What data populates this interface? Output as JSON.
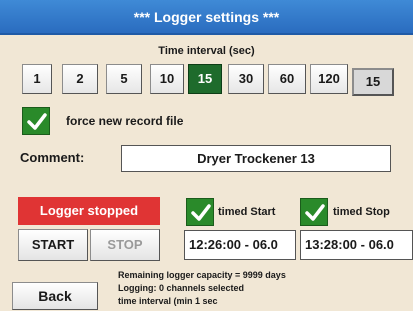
{
  "window": {
    "title": "***  Logger settings  ***"
  },
  "time_interval": {
    "label": "Time interval (sec)",
    "options": [
      "1",
      "2",
      "5",
      "10",
      "15",
      "30",
      "60",
      "120"
    ],
    "selected": "15",
    "current_value": "15"
  },
  "force_new_record": {
    "label": "force new record file",
    "checked": true
  },
  "comment": {
    "label": "Comment:",
    "value": "Dryer Trockener 13"
  },
  "status": {
    "text": "Logger stopped",
    "color": "#e03434"
  },
  "timed_start": {
    "label": "timed Start",
    "checked": true,
    "value": "12:26:00 - 06.0"
  },
  "timed_stop": {
    "label": "timed Stop",
    "checked": true,
    "value": "13:28:00 - 06.0"
  },
  "buttons": {
    "start": "START",
    "stop": "STOP",
    "back": "Back"
  },
  "info_lines": [
    "Remaining logger capacity = 9999 days",
    "Logging: 0 channels selected",
    "time interval (min 1 sec"
  ],
  "colors": {
    "title_bar": "#2a6cbf",
    "background": "#f1e7d5",
    "checkbox": "#2a8a2a",
    "selected_interval": "#1e6b2c"
  }
}
